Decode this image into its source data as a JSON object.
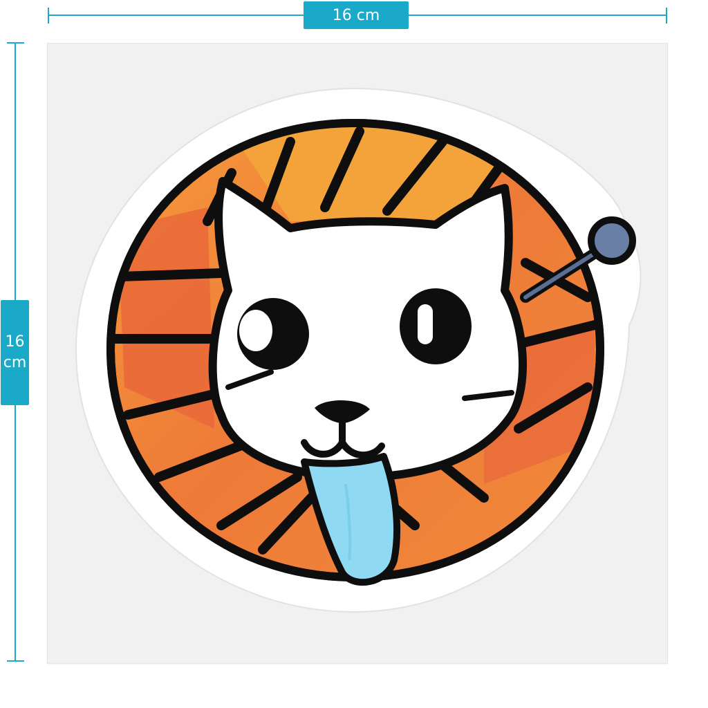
{
  "dimensions": {
    "width_label": "16 cm",
    "height_label": "16\ncm"
  },
  "colors": {
    "accent": "#1ba9c9",
    "sheet": "#f1f1f1",
    "yarn_orange": "#f08a3a",
    "yarn_red": "#e9673a",
    "yarn_light": "#f3a33a",
    "tongue": "#8fd9f2",
    "needle_head": "#6a7fa6",
    "outline": "#0e0e0e"
  },
  "illustration": {
    "icon": "cat-with-yarn-ball-sticker"
  }
}
